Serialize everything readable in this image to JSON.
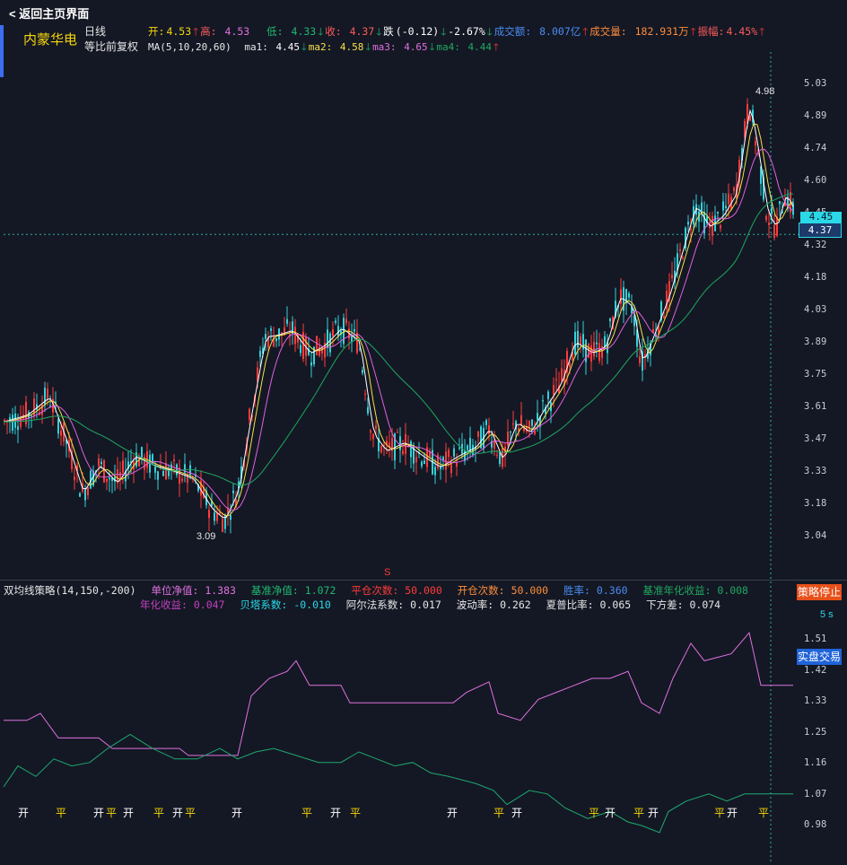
{
  "header": {
    "back_label": "返回主页界面",
    "stock_name": "内蒙华电",
    "period": "日线",
    "adjust": "等比前复权"
  },
  "quote": {
    "open_label": "开:",
    "open": "4.53",
    "high_label": "高:",
    "high": "4.53",
    "low_label": "低:",
    "low": "4.33",
    "close_label": "收:",
    "close": "4.37",
    "change_label": "跌",
    "change": "(-0.12)",
    "change_pct": "-2.67%",
    "amount_label": "成交额:",
    "amount": "8.007亿",
    "volume_label": "成交量:",
    "volume": "182.931万",
    "amplitude_label": "振幅:",
    "amplitude": "4.45%"
  },
  "ma": {
    "title": "MA(5,10,20,60)",
    "ma1_label": "ma1:",
    "ma1": "4.45",
    "ma2_label": "ma2:",
    "ma2": "4.58",
    "ma3_label": "ma3:",
    "ma3": "4.65",
    "ma4_label": "ma4:",
    "ma4": "4.44"
  },
  "price_axis": [
    "5.03",
    "4.89",
    "4.74",
    "4.60",
    "4.45",
    "4.32",
    "4.18",
    "4.03",
    "3.89",
    "3.75",
    "3.61",
    "3.47",
    "3.33",
    "3.18",
    "3.04"
  ],
  "price_box_top": "4.45",
  "price_box_current": "4.37",
  "annotations": {
    "high": "4.98",
    "low": "3.09",
    "marker_s": "S"
  },
  "strategy": {
    "name": "双均线策略(14,150,-200)",
    "unit_nav_label": "单位净值:",
    "unit_nav": "1.383",
    "bench_nav_label": "基准净值:",
    "bench_nav": "1.072",
    "close_count_label": "平仓次数:",
    "close_count": "50.000",
    "open_count_label": "开仓次数:",
    "open_count": "50.000",
    "win_rate_label": "胜率:",
    "win_rate": "0.360",
    "bench_annual_label": "基准年化收益:",
    "bench_annual": "0.008",
    "annual_label": "年化收益:",
    "annual": "0.047",
    "beta_label": "贝塔系数:",
    "beta": "-0.010",
    "alpha_label": "阿尔法系数:",
    "alpha": "0.017",
    "vol_label": "波动率:",
    "vol": "0.262",
    "sharpe_label": "夏普比率:",
    "sharpe": "0.065",
    "downside_label": "下方差:",
    "downside": "0.074"
  },
  "buttons": {
    "stop": "策略停止",
    "interval": "5 s",
    "live": "实盘交易"
  },
  "nav_axis": [
    "1.51",
    "1.42",
    "1.33",
    "1.25",
    "1.16",
    "1.07",
    "0.98"
  ],
  "signals": [
    {
      "text": "开",
      "type": "open"
    },
    {
      "text": "平",
      "type": "close"
    },
    {
      "text": "开",
      "type": "open"
    },
    {
      "text": "平",
      "type": "close"
    },
    {
      "text": "开",
      "type": "open"
    },
    {
      "text": "平",
      "type": "close"
    },
    {
      "text": "开",
      "type": "open"
    },
    {
      "text": "平",
      "type": "close"
    },
    {
      "text": "开",
      "type": "open"
    },
    {
      "text": "平",
      "type": "close"
    },
    {
      "text": "开",
      "type": "open"
    },
    {
      "text": "平",
      "type": "close"
    },
    {
      "text": "开",
      "type": "open"
    },
    {
      "text": "平",
      "type": "close"
    },
    {
      "text": "开",
      "type": "open"
    },
    {
      "text": "平",
      "type": "close"
    },
    {
      "text": "开",
      "type": "open"
    },
    {
      "text": "平",
      "type": "close"
    },
    {
      "text": "开",
      "type": "open"
    },
    {
      "text": "平",
      "type": "close"
    },
    {
      "text": "开",
      "type": "open"
    },
    {
      "text": "平",
      "type": "close"
    }
  ],
  "colors": {
    "up": "#ff3b3b",
    "down": "#35d0d8",
    "ma1": "#ffffff",
    "ma2": "#f5e14a",
    "ma3": "#e060e0",
    "ma4": "#1fa860",
    "unit_nav": "#e070e0",
    "bench_nav": "#1fa870",
    "open": "#ffffff",
    "close": "#f5d60a"
  }
}
